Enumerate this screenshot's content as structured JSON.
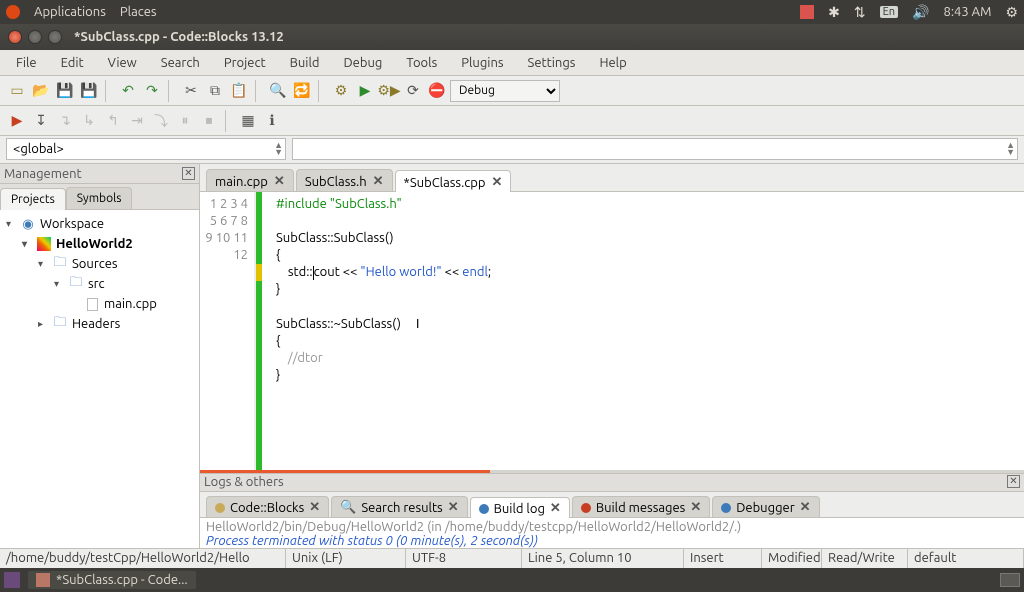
{
  "sysbar": {
    "apps": "Applications",
    "places": "Places",
    "lang": "En",
    "time": "8:43 AM"
  },
  "window": {
    "title": "*SubClass.cpp - Code::Blocks 13.12"
  },
  "menu": [
    "File",
    "Edit",
    "View",
    "Search",
    "Project",
    "Build",
    "Debug",
    "Tools",
    "Plugins",
    "Settings",
    "Help"
  ],
  "toolbar": {
    "target": "Debug"
  },
  "scope": {
    "left": "<global>"
  },
  "mgmt": {
    "title": "Management",
    "tabs": [
      "Projects",
      "Symbols"
    ],
    "active_tab": 0,
    "tree": {
      "workspace": "Workspace",
      "project": "HelloWorld2",
      "sources": "Sources",
      "src": "src",
      "maincpp": "main.cpp",
      "headers": "Headers"
    }
  },
  "editor": {
    "tabs": [
      {
        "label": "main.cpp",
        "active": false
      },
      {
        "label": "SubClass.h",
        "active": false
      },
      {
        "label": "*SubClass.cpp",
        "active": true
      }
    ],
    "lines": [
      1,
      2,
      3,
      4,
      5,
      6,
      7,
      8,
      9,
      10,
      11,
      12
    ]
  },
  "logs": {
    "title": "Logs & others",
    "tabs": [
      "Code::Blocks",
      "Search results",
      "Build log",
      "Build messages",
      "Debugger"
    ],
    "active": 2,
    "line1": "HelloWorld2/bin/Debug/HelloWorld2  (in /home/buddy/testcpp/HelloWorld2/HelloWorld2/.)",
    "line2": "Process terminated with status 0 (0 minute(s), 2 second(s))"
  },
  "status": {
    "path": "/home/buddy/testCpp/HelloWorld2/Hello",
    "eol": "Unix (LF)",
    "enc": "UTF-8",
    "pos": "Line 5, Column 10",
    "ins": "Insert",
    "mod": "Modified",
    "rw": "Read/Write",
    "prof": "default"
  },
  "taskbar": {
    "item": "*SubClass.cpp - Code..."
  }
}
